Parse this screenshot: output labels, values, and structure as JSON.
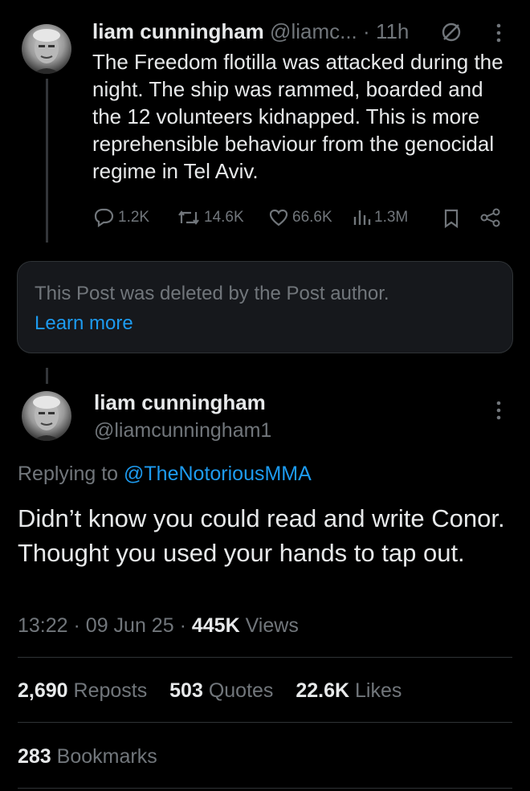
{
  "parent_post": {
    "display_name": "liam cunningham",
    "handle": "@liamc...",
    "separator": "·",
    "time": "11h",
    "text": "The Freedom flotilla was attacked during the night. The ship was rammed, boarded and the 12 volunteers kidnapped. This is more reprehensible behaviour from the genocidal regime in Tel Aviv.",
    "actions": {
      "replies": "1.2K",
      "reposts": "14.6K",
      "likes": "66.6K",
      "views": "1.3M"
    }
  },
  "deleted_notice": {
    "text": "This Post was deleted by the Post author.",
    "link": "Learn more"
  },
  "main_post": {
    "display_name": "liam cunningham",
    "handle": "@liamcunningham1",
    "replying_prefix": "Replying to",
    "replying_to": "@TheNotoriousMMA",
    "text": "Didn’t know you could read and write Conor. Thought you used your hands to tap out.",
    "time": "13:22",
    "date": "09 Jun 25",
    "dot": "·",
    "views_count": "445K",
    "views_label": "Views"
  },
  "stats": {
    "reposts_count": "2,690",
    "reposts_label": "Reposts",
    "quotes_count": "503",
    "quotes_label": "Quotes",
    "likes_count": "22.6K",
    "likes_label": "Likes",
    "bookmarks_count": "283",
    "bookmarks_label": "Bookmarks"
  }
}
